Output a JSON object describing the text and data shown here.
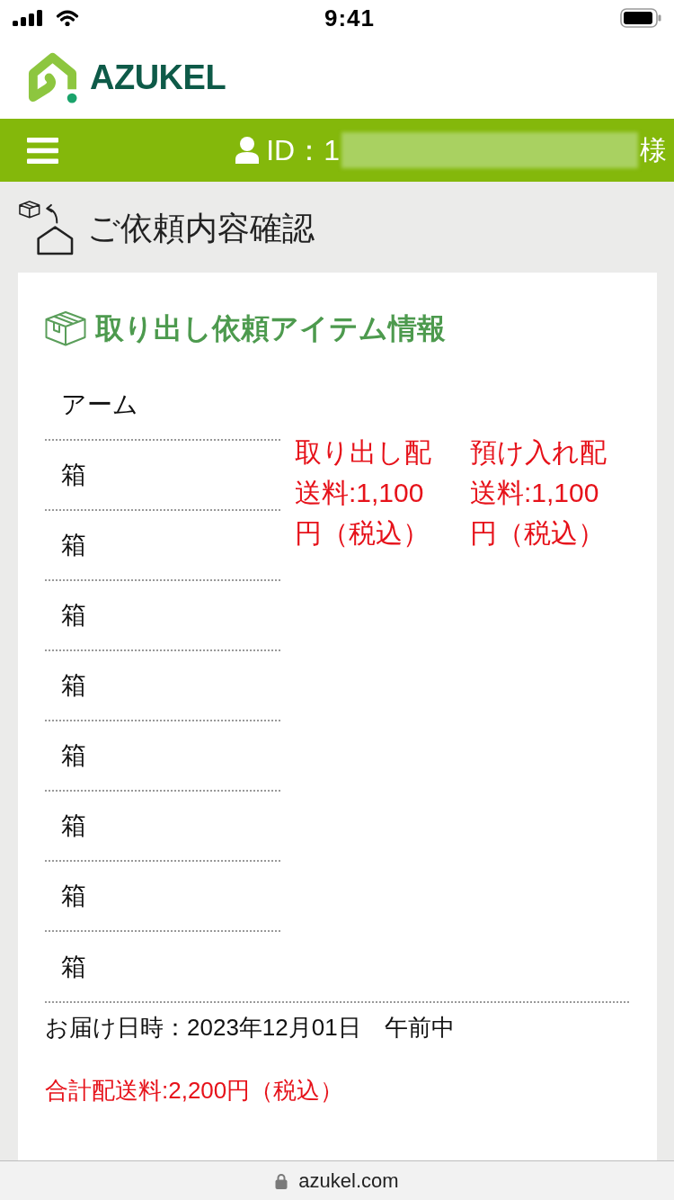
{
  "status_bar": {
    "time": "9:41"
  },
  "header": {
    "logo_text": "AZUKEL"
  },
  "nav_bar": {
    "id_label": "ID：1",
    "honorific": "様"
  },
  "page": {
    "title": "ご依頼内容確認"
  },
  "card": {
    "title": "取り出し依頼アイテム情報",
    "items": [
      {
        "name": "アーム"
      },
      {
        "name": "箱"
      },
      {
        "name": "箱"
      },
      {
        "name": "箱"
      },
      {
        "name": "箱"
      },
      {
        "name": "箱"
      },
      {
        "name": "箱"
      },
      {
        "name": "箱"
      },
      {
        "name": "箱"
      }
    ],
    "fees": [
      "取り出し配送料:1,100円（税込）",
      "預け入れ配送料:1,100円（税込）"
    ],
    "delivery": "お届け日時：2023年12月01日　午前中",
    "total": "合計配送料:2,200円（税込）"
  },
  "browser_bar": {
    "url": "azukel.com"
  }
}
